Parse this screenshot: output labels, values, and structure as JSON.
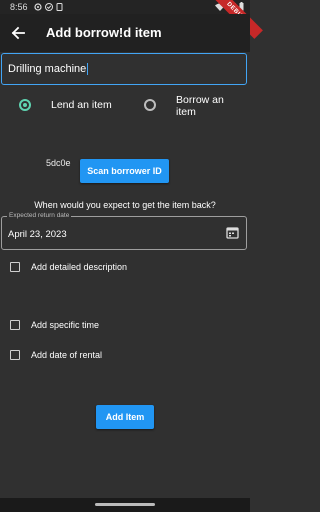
{
  "status_bar": {
    "time": "8:56"
  },
  "debug_banner": "DEBUG",
  "app_bar": {
    "title": "Add borrow!d item"
  },
  "item_name": {
    "value": "Drilling machine"
  },
  "radios": {
    "lend_label": "Lend an item",
    "lend_selected": true,
    "borrow_label": "Borrow an item",
    "borrow_selected": false
  },
  "scan_button": {
    "label": "Scan borrower ID"
  },
  "borrower_code": "5dc0e",
  "return_question": "When would you expect to get the item back?",
  "return_date": {
    "label": "Expected return date",
    "value": "April 23, 2023"
  },
  "options": [
    {
      "label": "Add detailed description",
      "checked": false
    },
    {
      "label": "Add specific time",
      "checked": false
    },
    {
      "label": "Add date of rental",
      "checked": false
    }
  ],
  "add_button": {
    "label": "Add Item"
  },
  "colors": {
    "accent": "#2196f3",
    "radio_selected": "#5fd3b0",
    "background": "#303030",
    "app_bar": "#212121"
  }
}
